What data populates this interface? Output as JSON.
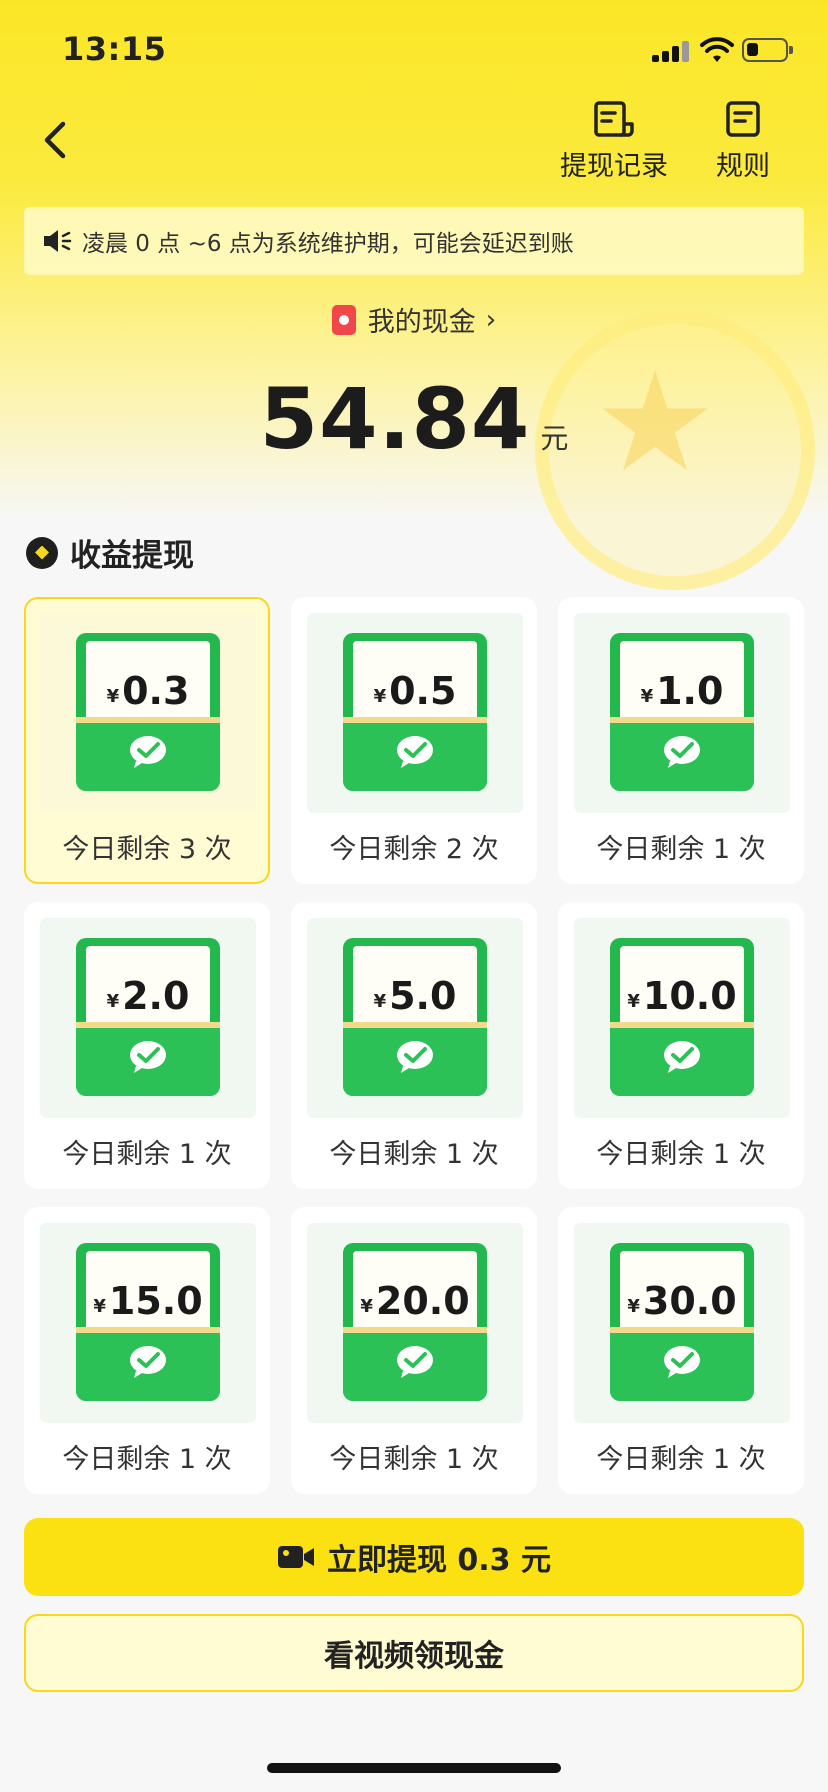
{
  "status_bar": {
    "time": "13:15"
  },
  "header": {
    "record_label": "提现记录",
    "rules_label": "规则"
  },
  "notice": {
    "text": "凌晨 0 点 ~6 点为系统维护期，可能会延迟到账"
  },
  "balance": {
    "cash_label": "我的现金",
    "amount": "54.84",
    "unit": "元"
  },
  "section": {
    "title": "收益提现"
  },
  "options": [
    {
      "currency": "¥",
      "amount": "0.3",
      "remaining": "今日剩余 3 次",
      "selected": true
    },
    {
      "currency": "¥",
      "amount": "0.5",
      "remaining": "今日剩余 2 次",
      "selected": false
    },
    {
      "currency": "¥",
      "amount": "1.0",
      "remaining": "今日剩余 1 次",
      "selected": false
    },
    {
      "currency": "¥",
      "amount": "2.0",
      "remaining": "今日剩余 1 次",
      "selected": false
    },
    {
      "currency": "¥",
      "amount": "5.0",
      "remaining": "今日剩余 1 次",
      "selected": false
    },
    {
      "currency": "¥",
      "amount": "10.0",
      "remaining": "今日剩余 1 次",
      "selected": false
    },
    {
      "currency": "¥",
      "amount": "15.0",
      "remaining": "今日剩余 1 次",
      "selected": false
    },
    {
      "currency": "¥",
      "amount": "20.0",
      "remaining": "今日剩余 1 次",
      "selected": false
    },
    {
      "currency": "¥",
      "amount": "30.0",
      "remaining": "今日剩余 1 次",
      "selected": false
    }
  ],
  "actions": {
    "withdraw_label": "立即提现 0.3 元",
    "watch_video_label": "看视频领现金"
  },
  "colors": {
    "brand_yellow": "#fbe112",
    "envelope_green": "#22b84e",
    "selected_border": "#f8d71c"
  },
  "icons": {
    "back": "chevron-left-icon",
    "record": "receipt-icon",
    "rules": "document-icon",
    "notice": "speaker-icon",
    "cash": "red-wallet-icon",
    "section": "diamond-coin-icon",
    "withdraw": "video-camera-icon",
    "payment": "wechat-icon"
  }
}
